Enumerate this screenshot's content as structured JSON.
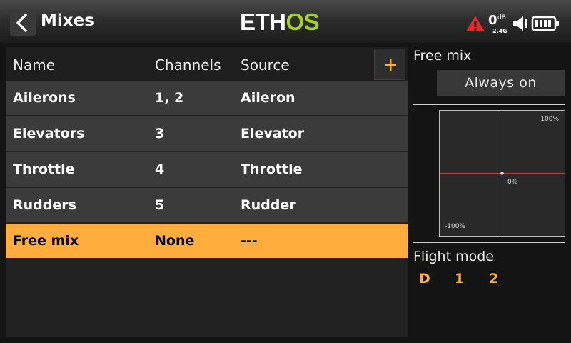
{
  "header": {
    "title": "Mixes",
    "logo_white": "ETH",
    "logo_green": "OS",
    "rssi_value": "0",
    "rssi_unit": "dB",
    "band": "2.4G",
    "warning_icon": "warning-triangle-icon",
    "speaker_icon": "speaker-icon",
    "battery_icon": "battery-icon"
  },
  "table": {
    "columns": [
      "Name",
      "Channels",
      "Source"
    ],
    "add_label": "+",
    "rows": [
      {
        "name": "Ailerons",
        "channels": "1, 2",
        "source": "Aileron"
      },
      {
        "name": "Elevators",
        "channels": "3",
        "source": "Elevator"
      },
      {
        "name": "Throttle",
        "channels": "4",
        "source": "Throttle"
      },
      {
        "name": "Rudders",
        "channels": "5",
        "source": "Rudder"
      },
      {
        "name": "Free mix",
        "channels": "None",
        "source": "---"
      }
    ],
    "selected_row": "Free mix"
  },
  "side": {
    "title": "Free mix",
    "active_condition": "Always on",
    "curve": {
      "max_label": "100%",
      "zero_label": "0%",
      "min_label": "-100%"
    },
    "flight_mode_title": "Flight mode",
    "flight_modes": [
      "D",
      "1",
      "2"
    ]
  },
  "colors": {
    "accent": "#ffad3d",
    "logo_green": "#a6cf2a",
    "warning": "#e5262b",
    "curve_line": "#e0282e"
  }
}
